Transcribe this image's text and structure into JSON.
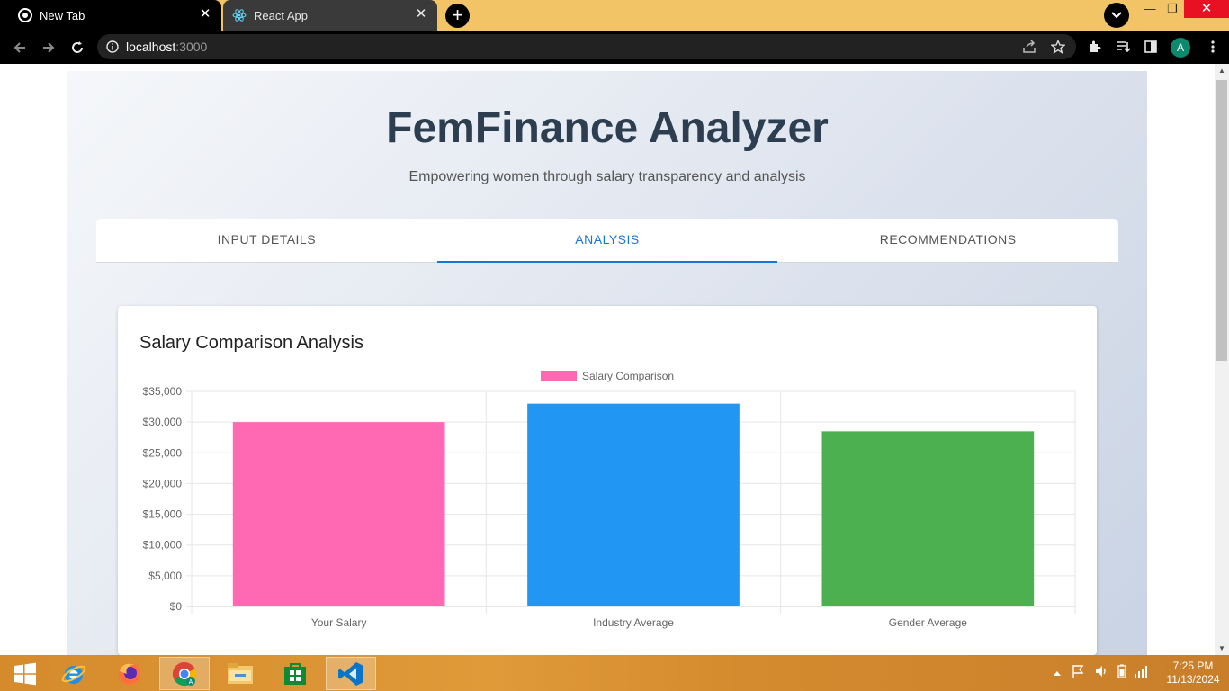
{
  "browser": {
    "tabs": [
      {
        "title": "New Tab",
        "icon": "chrome-icon"
      },
      {
        "title": "React App",
        "icon": "react-icon"
      }
    ],
    "address": {
      "host": "localhost",
      "port": ":3000"
    },
    "profile_initial": "A"
  },
  "app": {
    "title": "FemFinance Analyzer",
    "subtitle": "Empowering women through salary transparency and analysis",
    "tabs": [
      {
        "label": "INPUT DETAILS"
      },
      {
        "label": "ANALYSIS"
      },
      {
        "label": "RECOMMENDATIONS"
      }
    ],
    "active_tab": "ANALYSIS",
    "card_title": "Salary Comparison Analysis"
  },
  "chart_data": {
    "type": "bar",
    "title": "",
    "legend": {
      "label": "Salary Comparison",
      "placement": "top-center",
      "swatch_color": "#ff69b4"
    },
    "categories": [
      "Your Salary",
      "Industry Average",
      "Gender Average"
    ],
    "series": [
      {
        "name": "Salary Comparison",
        "values": [
          30000,
          33000,
          28500
        ],
        "colors": [
          "#ff69b4",
          "#2196f3",
          "#4caf50"
        ]
      }
    ],
    "y_ticks": [
      "$0",
      "$5,000",
      "$10,000",
      "$15,000",
      "$20,000",
      "$25,000",
      "$30,000",
      "$35,000"
    ],
    "ylim": [
      0,
      35000
    ],
    "grid": true,
    "xlabel": "",
    "ylabel": ""
  },
  "taskbar": {
    "time": "7:25 PM",
    "date": "11/13/2024",
    "apps": [
      "start-icon",
      "internet-explorer-icon",
      "firefox-icon",
      "chrome-icon",
      "file-explorer-icon",
      "store-icon",
      "vscode-icon"
    ]
  }
}
